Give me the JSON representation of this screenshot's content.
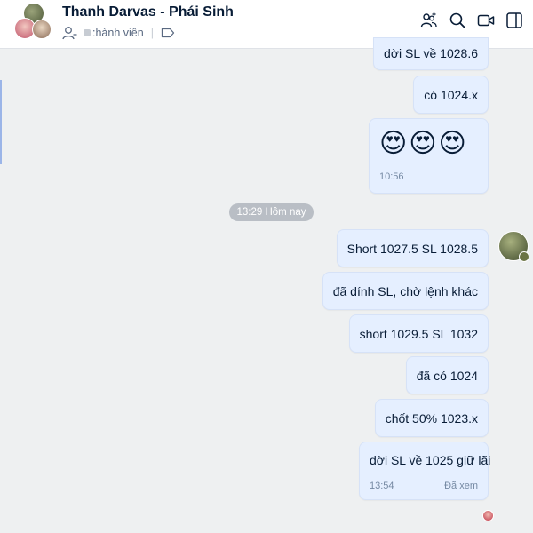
{
  "header": {
    "title": "Thanh Darvas - Phái Sinh",
    "members_label": ":hành viên",
    "icons": [
      "add-member-icon",
      "search-icon",
      "video-call-icon",
      "sidebar-toggle-icon"
    ]
  },
  "messages_before": [
    {
      "text": "dời SL về 1028.6"
    },
    {
      "text": "có 1024.x"
    },
    {
      "emoji": "😍😍😍",
      "time": "10:56"
    }
  ],
  "divider": {
    "label": "13:29 Hôm nay"
  },
  "messages_after": [
    {
      "text": "Short 1027.5 SL 1028.5"
    },
    {
      "text": "đã dính SL, chờ lệnh khác"
    },
    {
      "text": "short 1029.5 SL 1032"
    },
    {
      "text": "đã có 1024"
    },
    {
      "text": "chốt 50% 1023.x"
    },
    {
      "text": "dời SL về 1025 giữ lãi",
      "time": "13:54",
      "status": "Đã xem"
    }
  ],
  "colors": {
    "bubble": "#e5efff",
    "accent": "#0068ff",
    "divider_label_bg": "#b9bec5"
  }
}
